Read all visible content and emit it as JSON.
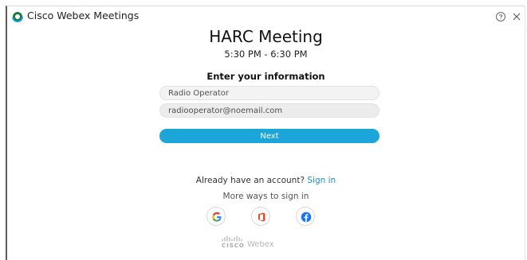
{
  "window": {
    "title": "Cisco Webex Meetings"
  },
  "meeting": {
    "title": "HARC Meeting",
    "time": "5:30 PM - 6:30 PM"
  },
  "form": {
    "heading": "Enter your information",
    "name_value": "Radio Operator",
    "email_value": "radiooperator@noemail.com",
    "next_label": "Next"
  },
  "account": {
    "prompt": "Already have an account?",
    "sign_in_label": "Sign in",
    "more_ways": "More ways to sign in"
  },
  "social": [
    "google-icon",
    "office-icon",
    "facebook-icon"
  ],
  "brand": {
    "cisco": "CISCO",
    "webex": "Webex"
  },
  "colors": {
    "accent": "#1ba5d8",
    "link": "#1a8fc9",
    "field_bg": "#f3f3f3"
  }
}
